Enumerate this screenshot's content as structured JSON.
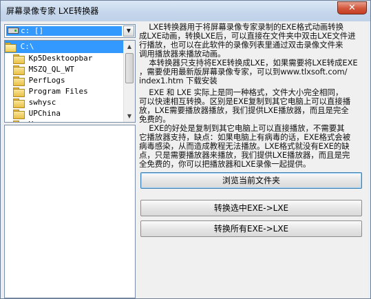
{
  "window": {
    "title": "屏幕录像专家 LXE转换器",
    "close_glyph": "✕"
  },
  "drive": {
    "selected": "c: []",
    "arrow_glyph": "▼"
  },
  "dirs": {
    "items": [
      {
        "label": "C:\\",
        "open": true,
        "selected": true
      },
      {
        "label": "Kp5Desktoopbar",
        "open": false,
        "selected": false
      },
      {
        "label": "MSZQ_QL_WT",
        "open": false,
        "selected": false
      },
      {
        "label": "PerfLogs",
        "open": false,
        "selected": false
      },
      {
        "label": "Program Files",
        "open": false,
        "selected": false
      },
      {
        "label": "swhysc",
        "open": false,
        "selected": false
      },
      {
        "label": "UPChina",
        "open": false,
        "selected": false
      },
      {
        "label": "V",
        "open": false,
        "selected": false
      }
    ],
    "scroll_up_glyph": "▲",
    "scroll_down_glyph": "▼"
  },
  "info": {
    "para1": "    LXE转换器用于将屏幕录像专家录制的EXE格式动画转换\n成LXE动画，转换LXE后，可以直接在文件夹中双击LXE文件进\n行播放，也可以在此软件的录像列表里通过双击录像文件来\n调用播放器来播放动画。",
    "para2": "    本转换器只支持将EXE转换成LXE，如果需要将LXE转成EXE\n，需要使用最新版屏幕录像专家，可以到www.tlxsoft.com/\nindex1.htm 下载安装",
    "para3": "    EXE 和 LXE 实际上是同一种格式，文件大小完全相同，\n可以快速相互转换。区别是EXE复制到其它电脑上可以直接播\n放，LXE需要播放器播放，我们提供LXE播放器，而且是完全\n免费的。",
    "para4": "    EXE的好处是复制到其它电脑上可以直接播放，不需要其\n它播放器支持，缺点：如果电脑上有病毒的话，EXE格式会被\n病毒感染，从而造成教程无法播放。LXE格式就没有EXE的缺\n点，只是需要播放器来播放，我们提供LXE播放器，而且是完\n全免费的，你可以把播放器和LXE录像一起提供。"
  },
  "buttons": {
    "browse": "浏览当前文件夹",
    "convert_selected": "转换选中EXE->LXE",
    "convert_all": "转换所有EXE->LXE"
  }
}
